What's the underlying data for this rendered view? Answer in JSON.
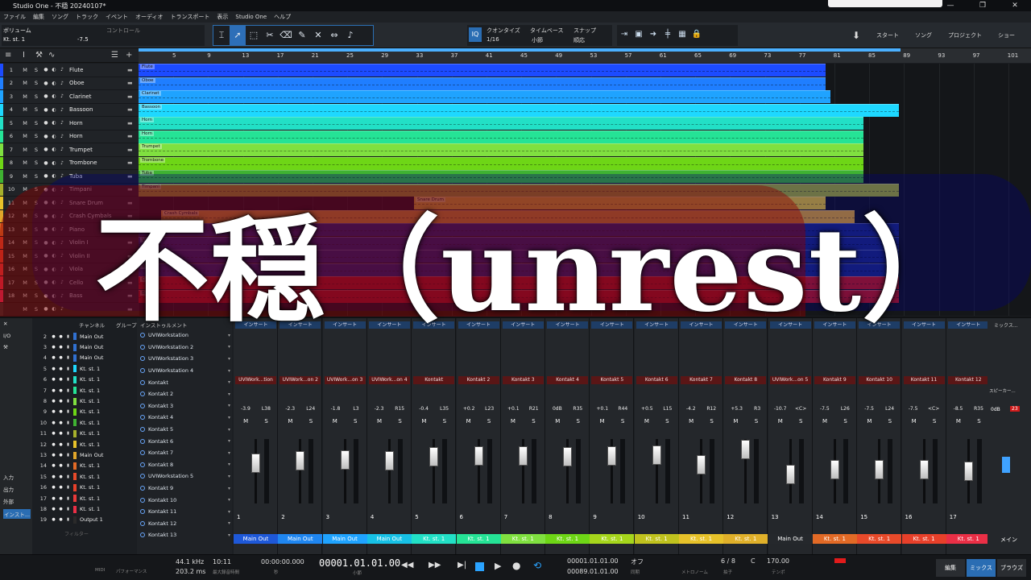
{
  "window": {
    "title": "Studio One - 不穏  20240107*"
  },
  "menu": [
    "ファイル",
    "編集",
    "ソング",
    "トラック",
    "イベント",
    "オーディオ",
    "トランスポート",
    "表示",
    "Studio One",
    "ヘルプ"
  ],
  "toolbar": {
    "track_label": "ボリューム",
    "control_label": "コントロール",
    "track_sub": "Kt. st. 1",
    "volume_value": "-7.5",
    "quantize_label": "クオンタイズ",
    "quantize_value": "1/16",
    "timebase_label": "タイムベース",
    "timebase_value": "小節",
    "snap_label": "スナップ",
    "snap_value": "順応",
    "iq_label": "IQ",
    "nav": [
      "スタート",
      "ソング",
      "プロジェクト",
      "ショー"
    ]
  },
  "ruler": {
    "ticks": [
      "5",
      "9",
      "13",
      "17",
      "21",
      "25",
      "29",
      "33",
      "37",
      "41",
      "45",
      "49",
      "53",
      "57",
      "61",
      "65",
      "69",
      "73",
      "77",
      "81",
      "85",
      "89",
      "93",
      "97",
      "101"
    ]
  },
  "tracks": [
    {
      "num": "1",
      "name": "Flute",
      "color": "#1c4bff"
    },
    {
      "num": "2",
      "name": "Oboe",
      "color": "#1f7eff"
    },
    {
      "num": "3",
      "name": "Clarinet",
      "color": "#1fa3ff"
    },
    {
      "num": "4",
      "name": "Bassoon",
      "color": "#1ed8ff"
    },
    {
      "num": "5",
      "name": "Horn",
      "color": "#22e0c6"
    },
    {
      "num": "6",
      "name": "Horn",
      "color": "#25e396"
    },
    {
      "num": "7",
      "name": "Trumpet",
      "color": "#80e040"
    },
    {
      "num": "8",
      "name": "Trombone",
      "color": "#6ed616"
    },
    {
      "num": "9",
      "name": "Tuba",
      "color": "#3fb232"
    },
    {
      "num": "10",
      "name": "Timpani",
      "color": "#a6b02c"
    },
    {
      "num": "11",
      "name": "Snare Drum",
      "color": "#e7c22a"
    },
    {
      "num": "12",
      "name": "Crash Cymbals",
      "color": "#e0a52a"
    },
    {
      "num": "13",
      "name": "Piano",
      "color": "#e26a26"
    },
    {
      "num": "14",
      "name": "Violin I",
      "color": "#e84a2a"
    },
    {
      "num": "15",
      "name": "Violin II",
      "color": "#e8402a"
    },
    {
      "num": "16",
      "name": "Viola",
      "color": "#ea3a3a"
    },
    {
      "num": "17",
      "name": "Cello",
      "color": "#ea2f46"
    },
    {
      "num": "18",
      "name": "Bass",
      "color": "#ea2f5a"
    },
    {
      "num": "",
      "name": "",
      "color": "#333"
    }
  ],
  "clips": [
    {
      "name": "Flute",
      "end": 0.77,
      "color": "#1c4bff"
    },
    {
      "name": "Oboe",
      "end": 0.77,
      "color": "#1f7eff"
    },
    {
      "name": "Clarinet",
      "end": 0.775,
      "color": "#1fa3ff"
    },
    {
      "name": "Bassoon",
      "end": 0.852,
      "color": "#1ed8ff"
    },
    {
      "name": "Horn",
      "end": 0.812,
      "color": "#22e0c6"
    },
    {
      "name": "Horn",
      "end": 0.812,
      "color": "#25e396"
    },
    {
      "name": "Trumpet",
      "end": 0.812,
      "color": "#80e040"
    },
    {
      "name": "Trombone",
      "end": 0.812,
      "color": "#6ed616"
    },
    {
      "name": "Tuba",
      "end": 0.812,
      "color": "#3fb232"
    },
    {
      "name": "Timpani",
      "end": 0.852,
      "color": "#a6b02c"
    },
    {
      "name": "Snare Drum",
      "end": 0.77,
      "color": "#e7c22a"
    },
    {
      "name": "Crash Cymbals",
      "end": 0.802,
      "color": "#e0a52a"
    },
    {
      "name": "Piano",
      "end": 0.852,
      "color": "#1c2a80"
    },
    {
      "name": "Violin I",
      "end": 0.852,
      "color": "#1c2a80"
    },
    {
      "name": "Violin II",
      "end": 0.852,
      "color": "#1c2a80"
    },
    {
      "name": "Viola",
      "end": 0.852,
      "color": "#1c2a80"
    },
    {
      "name": "Cello",
      "end": 0.852,
      "color": "#c41a1a"
    },
    {
      "name": "Bass",
      "end": 0.852,
      "color": "#c41a1a"
    }
  ],
  "mixer": {
    "list_headers": [
      "チャンネル",
      "グループ",
      "インストゥルメント"
    ],
    "left_labels": [
      "I/O",
      "入力",
      "出力",
      "外部",
      "インスト..."
    ],
    "channel_list": [
      {
        "num": "2",
        "name": "Main Out",
        "color": "#3070d0"
      },
      {
        "num": "3",
        "name": "Main Out",
        "color": "#3070d0"
      },
      {
        "num": "4",
        "name": "Main Out",
        "color": "#3070d0"
      },
      {
        "num": "5",
        "name": "Kt. st. 1",
        "color": "#1ed8ff"
      },
      {
        "num": "6",
        "name": "Kt. st. 1",
        "color": "#22e0c6"
      },
      {
        "num": "7",
        "name": "Kt. st. 1",
        "color": "#25e396"
      },
      {
        "num": "8",
        "name": "Kt. st. 1",
        "color": "#80e040"
      },
      {
        "num": "9",
        "name": "Kt. st. 1",
        "color": "#6ed616"
      },
      {
        "num": "10",
        "name": "Kt. st. 1",
        "color": "#3fb232"
      },
      {
        "num": "11",
        "name": "Kt. st. 1",
        "color": "#a6b02c"
      },
      {
        "num": "12",
        "name": "Kt. st. 1",
        "color": "#e7c22a"
      },
      {
        "num": "13",
        "name": "Main Out",
        "color": "#e0a52a"
      },
      {
        "num": "14",
        "name": "Kt. st. 1",
        "color": "#e26a26"
      },
      {
        "num": "15",
        "name": "Kt. st. 1",
        "color": "#e84a2a"
      },
      {
        "num": "16",
        "name": "Kt. st. 1",
        "color": "#e8402a"
      },
      {
        "num": "17",
        "name": "Kt. st. 1",
        "color": "#ea3a3a"
      },
      {
        "num": "18",
        "name": "Kt. st. 1",
        "color": "#ea2f46"
      },
      {
        "num": "19",
        "name": "Output 1",
        "color": "#2a2a2a"
      }
    ],
    "filter_placeholder": "フィルター",
    "instruments": [
      "UVIWorkstation",
      "UVIWorkstation 2",
      "UVIWorkstation 3",
      "UVIWorkstation 4",
      "Kontakt",
      "Kontakt 2",
      "Kontakt 3",
      "Kontakt 4",
      "Kontakt 5",
      "Kontakt 6",
      "Kontakt 7",
      "Kontakt 8",
      "UVIWorkstation 5",
      "Kontakt 9",
      "Kontakt 10",
      "Kontakt 11",
      "Kontakt 12",
      "Kontakt 13"
    ],
    "insert_label": "インサート",
    "strips": [
      {
        "inst": "UVIWork...tion",
        "pan_db": "-3.9",
        "pan": "L38",
        "num": "1",
        "out": "Main Out",
        "out_color": "#1e58d8",
        "fader": 0.62
      },
      {
        "inst": "UVIWork...on 2",
        "pan_db": "-2.3",
        "pan": "L24",
        "num": "2",
        "out": "Main Out",
        "out_color": "#1f86f0",
        "fader": 0.66
      },
      {
        "inst": "UVIWork...on 3",
        "pan_db": "-1.8",
        "pan": "L3",
        "num": "3",
        "out": "Main Out",
        "out_color": "#1fa3ff",
        "fader": 0.68
      },
      {
        "inst": "UVIWork...on 4",
        "pan_db": "-2.3",
        "pan": "R15",
        "num": "4",
        "out": "Main Out",
        "out_color": "#17c1e6",
        "fader": 0.66
      },
      {
        "inst": "Kontakt",
        "pan_db": "-0.4",
        "pan": "L35",
        "num": "5",
        "out": "Kt. st. 1",
        "out_color": "#22e0c6",
        "fader": 0.72
      },
      {
        "inst": "Kontakt 2",
        "pan_db": "+0.2",
        "pan": "L23",
        "num": "6",
        "out": "Kt. st. 1",
        "out_color": "#25e396",
        "fader": 0.74
      },
      {
        "inst": "Kontakt 3",
        "pan_db": "+0.1",
        "pan": "R21",
        "num": "7",
        "out": "Kt. st. 1",
        "out_color": "#80e040",
        "fader": 0.74
      },
      {
        "inst": "Kontakt 4",
        "pan_db": "0dB",
        "pan": "R35",
        "num": "8",
        "out": "Kt. st. 1",
        "out_color": "#6ed616",
        "fader": 0.73
      },
      {
        "inst": "Kontakt 5",
        "pan_db": "+0.1",
        "pan": "R44",
        "num": "9",
        "out": "Kt. st. 1",
        "out_color": "#a6d61c",
        "fader": 0.74
      },
      {
        "inst": "Kontakt 6",
        "pan_db": "+0.5",
        "pan": "L15",
        "num": "10",
        "out": "Kt. st. 1",
        "out_color": "#c0c21e",
        "fader": 0.75
      },
      {
        "inst": "Kontakt 7",
        "pan_db": "-4.2",
        "pan": "R12",
        "num": "11",
        "out": "Kt. st. 1",
        "out_color": "#e7c22a",
        "fader": 0.6
      },
      {
        "inst": "Kontakt 8",
        "pan_db": "+5.3",
        "pan": "R3",
        "num": "12",
        "out": "Kt. st. 1",
        "out_color": "#e0b02a",
        "fader": 0.84
      },
      {
        "inst": "UVIWork...on 5",
        "pan_db": "-10.7",
        "pan": "<C>",
        "num": "13",
        "out": "Main Out",
        "out_color": "#25282c",
        "fader": 0.45
      },
      {
        "inst": "Kontakt 9",
        "pan_db": "-7.5",
        "pan": "L26",
        "num": "14",
        "out": "Kt. st. 1",
        "out_color": "#e26a26",
        "fader": 0.52
      },
      {
        "inst": "Kontakt 10",
        "pan_db": "-7.5",
        "pan": "L24",
        "num": "15",
        "out": "Kt. st. 1",
        "out_color": "#e84a2a",
        "fader": 0.52
      },
      {
        "inst": "Kontakt 11",
        "pan_db": "-7.5",
        "pan": "<C>",
        "num": "16",
        "out": "Kt. st. 1",
        "out_color": "#e8402a",
        "fader": 0.52
      },
      {
        "inst": "Kontakt 12",
        "pan_db": "-8.5",
        "pan": "R35",
        "num": "17",
        "out": "Kt. st. 1",
        "out_color": "#ea2f46",
        "fader": 0.5
      }
    ],
    "main": {
      "label": "スピーカー...",
      "db": "0dB",
      "peak": "23",
      "out": "メイン",
      "mix": "ミックス..."
    }
  },
  "transport": {
    "sample_rate": "44.1 kHz",
    "latency": "203.2 ms",
    "time": "10:11",
    "time_sub": "最大録音時間",
    "sec_display": "00:00:00.000",
    "sec_sub": "秒",
    "main_pos": "00001.01.01.00",
    "main_sub": "小節",
    "loop_l": "00001.01.01.00",
    "loop_r": "00089.01.01.00",
    "offset": "オフ",
    "sync": "同期",
    "metronome": "メトロノーム",
    "signature": "6 / 8",
    "signature_sub": "拍子",
    "key": "C",
    "tempo": "170.00",
    "tempo_sub": "テンポ",
    "midi": "MIDI",
    "performance": "パフォーマンス",
    "edit": "編集",
    "mix": "ミックス",
    "browse": "ブラウズ"
  },
  "overlay_title": "不穏（unrest）"
}
